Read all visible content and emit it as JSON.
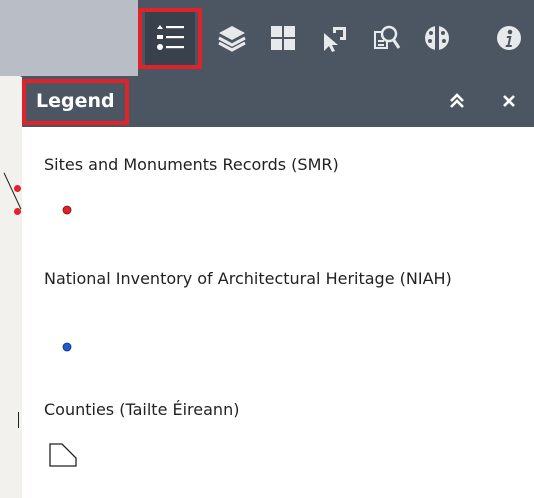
{
  "toolbar": {
    "tools": [
      {
        "name": "legend-icon",
        "active": true
      },
      {
        "name": "layers-icon",
        "active": false
      },
      {
        "name": "basemap-gallery-icon",
        "active": false
      },
      {
        "name": "select-icon",
        "active": false
      },
      {
        "name": "query-icon",
        "active": false
      },
      {
        "name": "palette-icon",
        "active": false
      },
      {
        "name": "info-icon",
        "active": false
      }
    ],
    "highlight_color": "#e0222a",
    "background_color": "#4c5663"
  },
  "panel": {
    "title": "Legend",
    "collapse_icon": "double-chevron-up-icon",
    "close_icon": "close-icon",
    "layers": [
      {
        "title": "Sites and Monuments Records (SMR)",
        "symbol": "point",
        "color": "#e0222a"
      },
      {
        "title": "National Inventory of Architectural Heritage (NIAH)",
        "symbol": "point",
        "color": "#1f5bd6"
      },
      {
        "title": "Counties (Tailte Éireann)",
        "symbol": "polygon-outline",
        "color": "#222222"
      }
    ]
  }
}
